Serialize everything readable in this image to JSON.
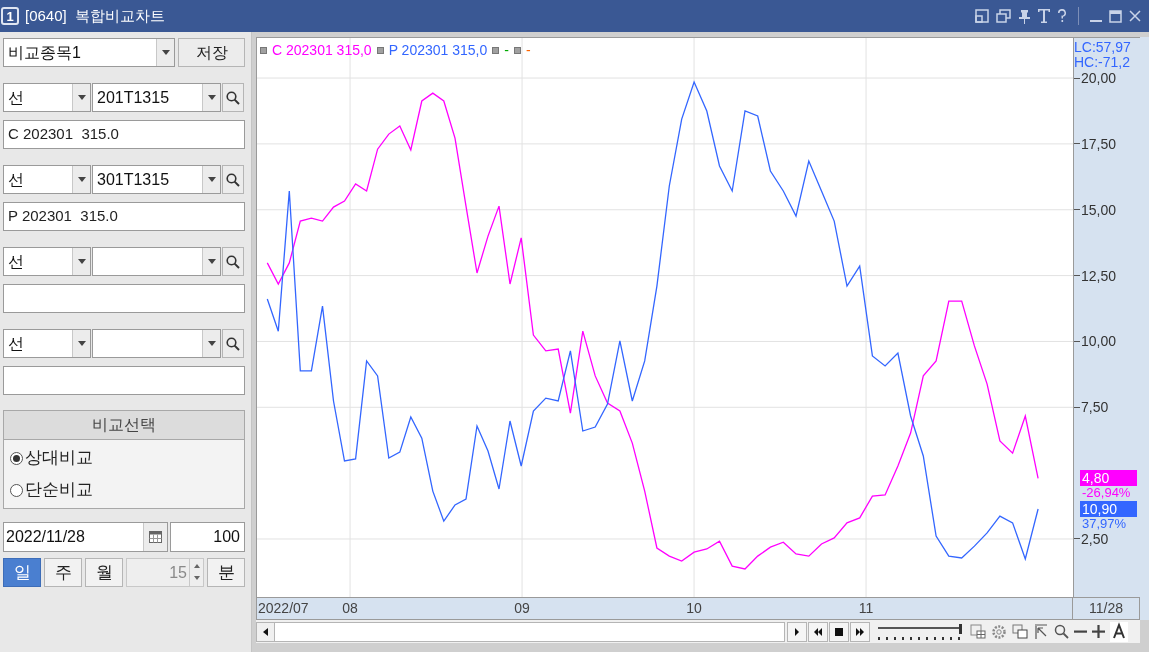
{
  "window": {
    "badge": "1",
    "title": "[0640]  복합비교차트"
  },
  "left_panel": {
    "compare_select": {
      "value": "비교종목1",
      "button": "저장"
    },
    "symbols": [
      {
        "type_value": "선",
        "code": "201T1315",
        "name": "C 202301  315.0"
      },
      {
        "type_value": "선",
        "code": "301T1315",
        "name": "P 202301  315.0"
      },
      {
        "type_value": "선"
      },
      {
        "type_value": "선"
      }
    ],
    "compare_mode": {
      "title": "비교선택",
      "options": [
        {
          "label": "상대비교",
          "selected": true
        },
        {
          "label": "단순비교",
          "selected": false
        }
      ]
    },
    "date": "2022/11/28",
    "count": "100",
    "periods": [
      {
        "label": "일",
        "selected": true
      },
      {
        "label": "주",
        "selected": false
      },
      {
        "label": "월",
        "selected": false
      }
    ],
    "minute_value": "15",
    "minute_button": "분"
  },
  "chart": {
    "legend_extra": [
      {
        "label": "-",
        "color": "#00aa00"
      },
      {
        "label": "-",
        "color": "#ff6600"
      }
    ],
    "axis_notes": [
      "LC:57,97",
      "HC:-71,2"
    ],
    "price_tags": [
      {
        "value": "4,80",
        "change": "-26,94%",
        "color": "#ff00ff"
      },
      {
        "value": "10,90",
        "change": "37,97%",
        "color": "#3366ff"
      }
    ],
    "first_date": "2022/07",
    "last_date": "11/28",
    "zoom_slider": {
      "level": 1
    },
    "chart_data": {
      "type": "line",
      "grid": true,
      "xlim": [
        7.459,
        12.209
      ],
      "ylim": [
        0.26,
        21.52
      ],
      "x": [
        7.519,
        7.583,
        7.647,
        7.711,
        7.775,
        7.84,
        7.904,
        7.968,
        8.032,
        8.096,
        8.16,
        8.225,
        8.289,
        8.353,
        8.417,
        8.481,
        8.545,
        8.61,
        8.674,
        8.738,
        8.802,
        8.866,
        8.93,
        8.995,
        9.066,
        9.138,
        9.21,
        9.281,
        9.353,
        9.425,
        9.497,
        9.569,
        9.641,
        9.713,
        9.784,
        9.856,
        9.928,
        10,
        10.074,
        10.148,
        10.222,
        10.296,
        10.37,
        10.444,
        10.519,
        10.593,
        10.667,
        10.741,
        10.815,
        10.889,
        10.963,
        11.037,
        11.111,
        11.185,
        11.259,
        11.333,
        11.407,
        11.481,
        11.556,
        11.63,
        11.704,
        11.778,
        11.852,
        11.926,
        12
      ],
      "xticks": [
        {
          "value": 8,
          "label": "08"
        },
        {
          "value": 9,
          "label": "09"
        },
        {
          "value": 10,
          "label": "10"
        },
        {
          "value": 11,
          "label": "11"
        }
      ],
      "yticks": [
        {
          "value": 2.5,
          "label": "2,50"
        },
        {
          "value": 7.5,
          "label": "7,50"
        },
        {
          "value": 10,
          "label": "10,00"
        },
        {
          "value": 12.5,
          "label": "12,50"
        },
        {
          "value": 15,
          "label": "15,00"
        },
        {
          "value": 17.5,
          "label": "17,50"
        },
        {
          "value": 20,
          "label": "20,00"
        }
      ],
      "series": [
        {
          "name": "C 202301 315,0",
          "color": "#ff00ff",
          "values": [
            12.98,
            12.18,
            12.98,
            14.57,
            14.68,
            14.57,
            15.1,
            15.33,
            15.98,
            15.71,
            17.3,
            17.87,
            18.18,
            17.27,
            19.13,
            19.43,
            19.13,
            17.72,
            15.14,
            12.6,
            14.0,
            15.14,
            12.18,
            13.93,
            10.24,
            9.64,
            9.71,
            7.28,
            10.39,
            8.69,
            7.66,
            7.36,
            6.14,
            4.32,
            2.16,
            1.85,
            1.66,
            2.0,
            2.12,
            2.42,
            1.47,
            1.36,
            1.85,
            2.19,
            2.38,
            1.93,
            1.85,
            2.31,
            2.54,
            3.11,
            3.3,
            4.13,
            4.17,
            5.27,
            6.52,
            8.69,
            9.26,
            11.53,
            11.53,
            9.83,
            8.38,
            6.22,
            5.76,
            7.17,
            4.8
          ]
        },
        {
          "name": "P 202301 315,0",
          "color": "#3366ff",
          "values": [
            11.61,
            10.39,
            15.71,
            8.88,
            8.88,
            11.34,
            7.74,
            5.46,
            5.54,
            9.26,
            8.69,
            5.57,
            5.8,
            7.13,
            6.33,
            4.32,
            3.18,
            3.79,
            4.02,
            6.79,
            5.84,
            4.4,
            6.98,
            5.27,
            7.36,
            7.85,
            7.74,
            9.64,
            6.6,
            6.75,
            7.62,
            10.02,
            7.74,
            9.26,
            12.1,
            15.9,
            18.44,
            19.85,
            18.75,
            16.66,
            15.71,
            18.75,
            18.56,
            16.47,
            15.71,
            14.76,
            16.85,
            15.71,
            14.57,
            12.1,
            12.86,
            9.45,
            9.07,
            9.56,
            7.17,
            5.65,
            2.61,
            1.85,
            1.78,
            2.23,
            2.73,
            3.37,
            3.11,
            1.74,
            3.64
          ]
        }
      ]
    }
  }
}
